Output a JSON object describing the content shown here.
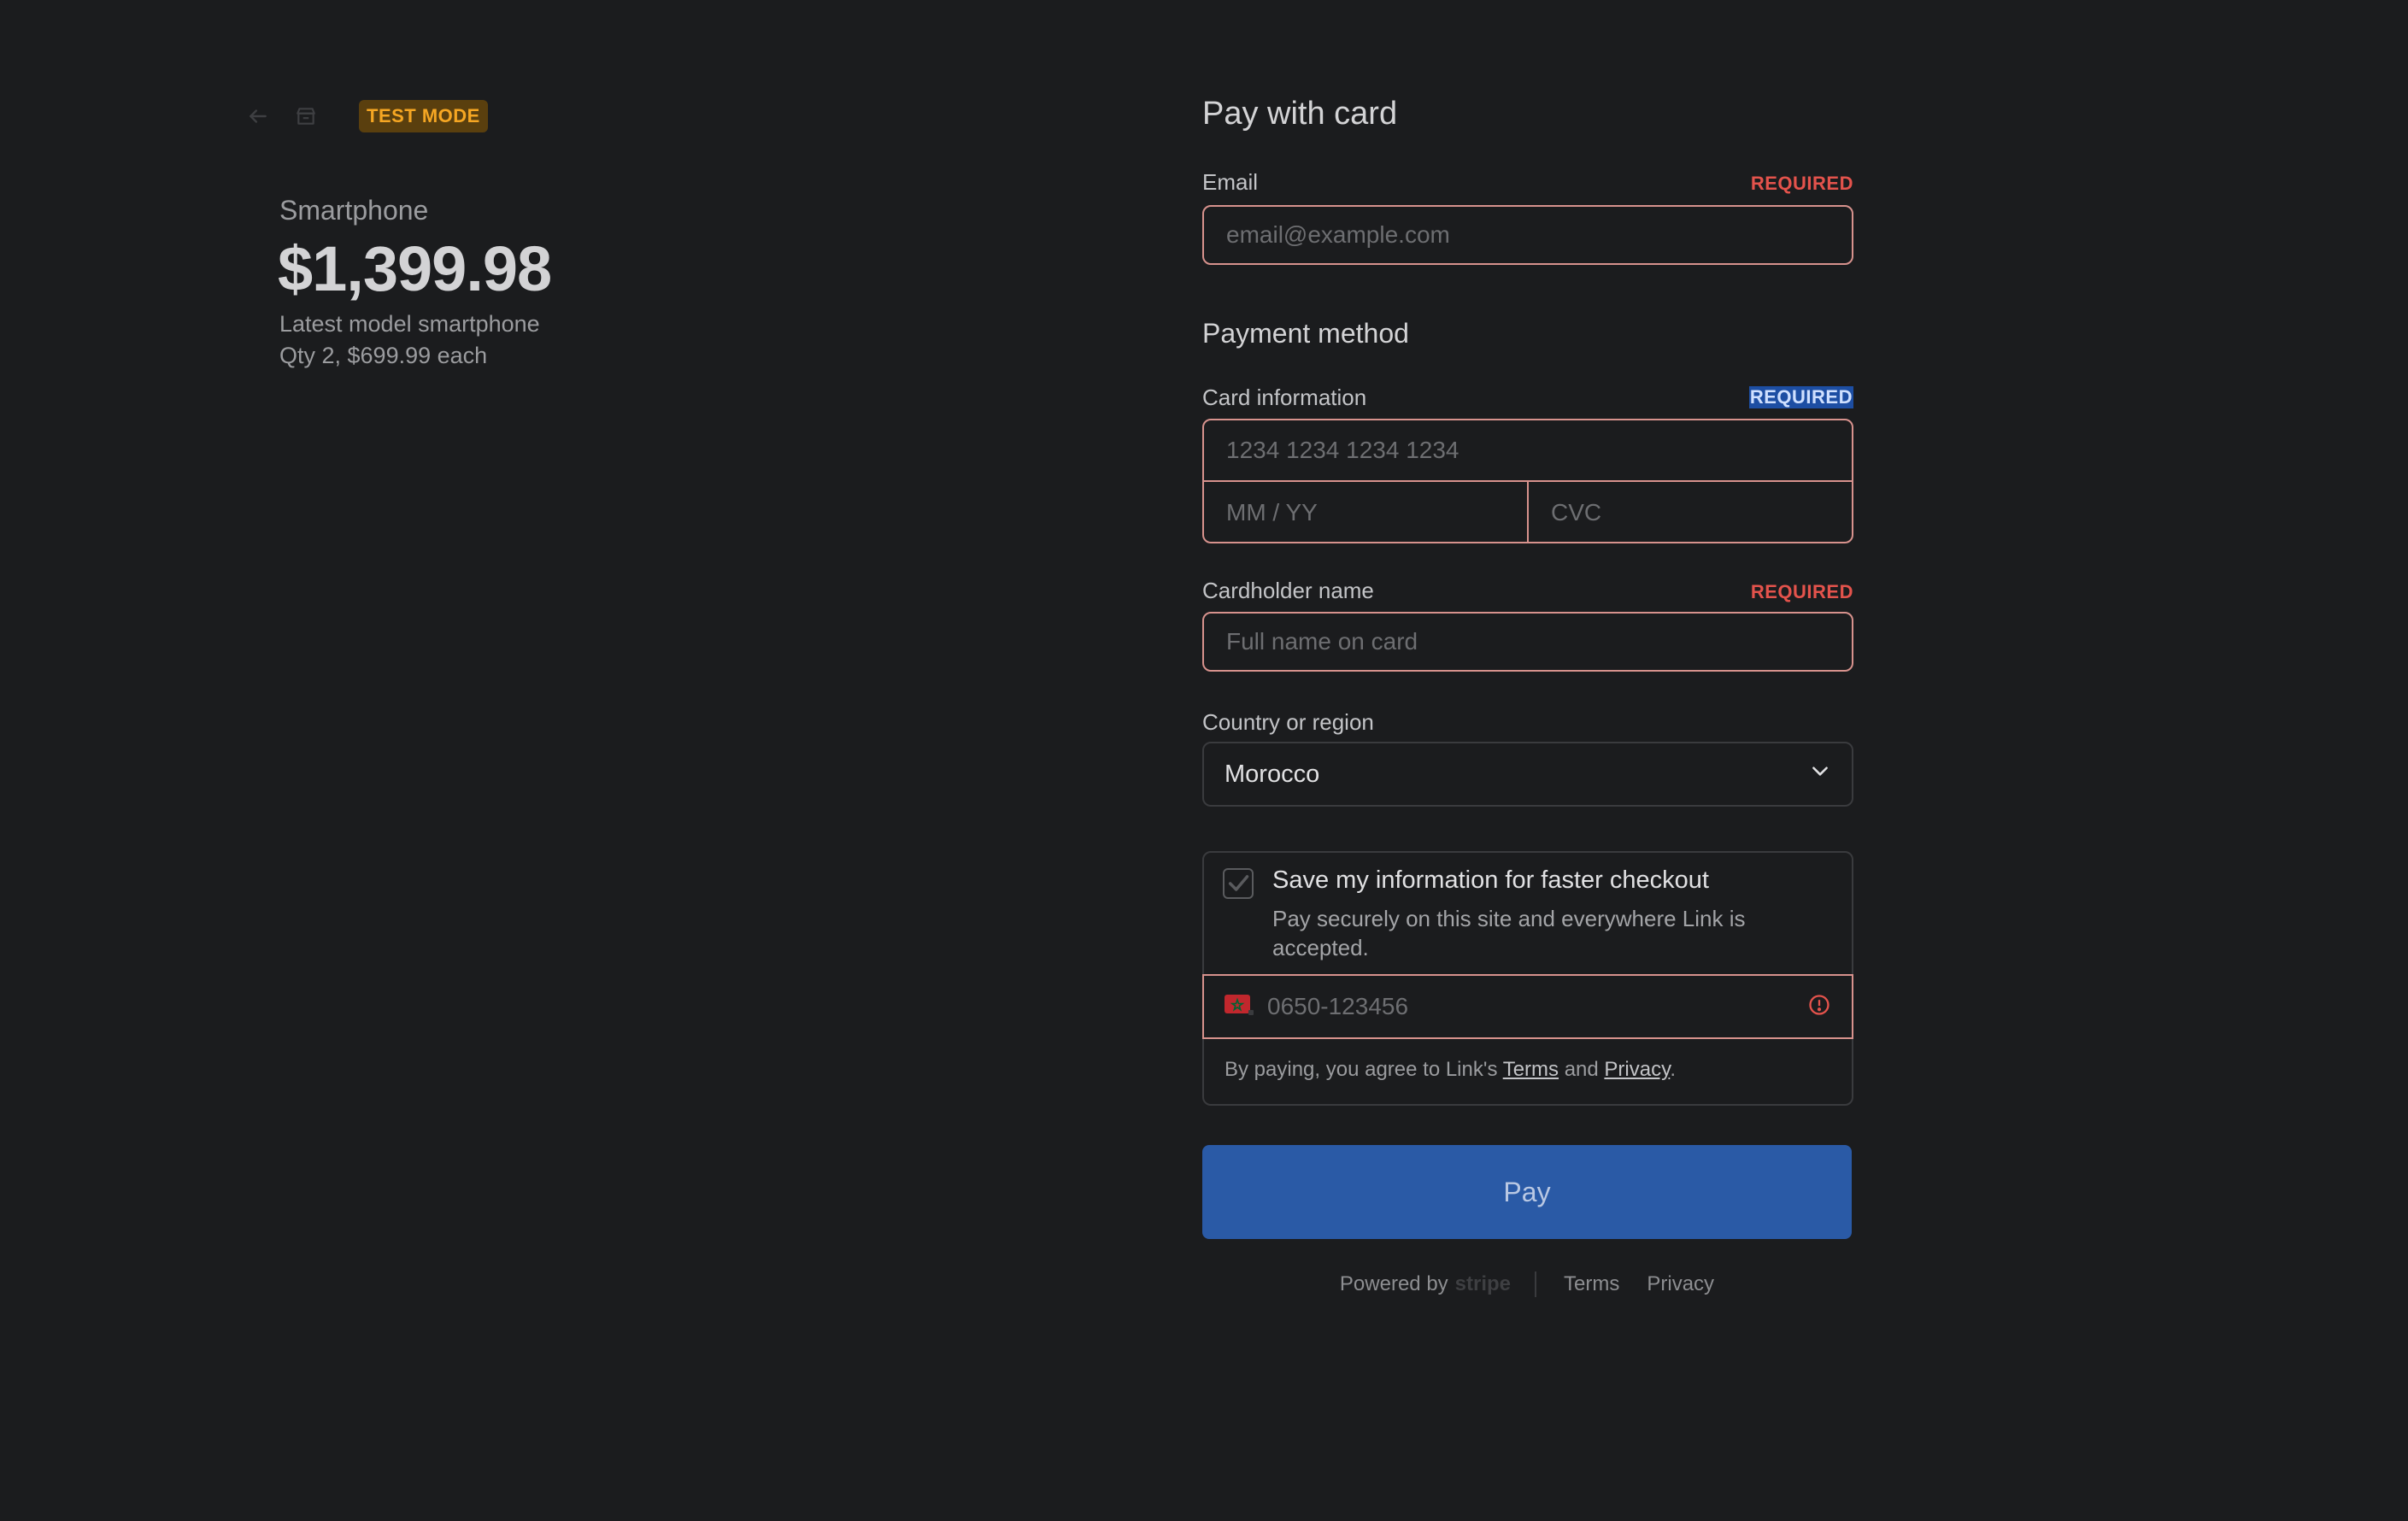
{
  "header": {
    "badge": "TEST MODE"
  },
  "summary": {
    "product_name": "Smartphone",
    "price": "$1,399.98",
    "description": "Latest model smartphone",
    "quantity_line": "Qty 2, $699.99 each"
  },
  "form": {
    "title": "Pay with card",
    "email": {
      "label": "Email",
      "required": "REQUIRED",
      "placeholder": "email@example.com"
    },
    "payment_method_heading": "Payment method",
    "card": {
      "label": "Card information",
      "required": "REQUIRED",
      "number_placeholder": "1234 1234 1234 1234",
      "expiry_placeholder": "MM / YY",
      "cvc_placeholder": "CVC"
    },
    "cardholder": {
      "label": "Cardholder name",
      "required": "REQUIRED",
      "placeholder": "Full name on card"
    },
    "country": {
      "label": "Country or region",
      "value": "Morocco"
    },
    "link": {
      "title": "Save my information for faster checkout",
      "description": "Pay securely on this site and everywhere Link is accepted.",
      "phone_placeholder": "0650-123456",
      "terms_prefix": "By paying, you agree to Link's",
      "terms_link": "Terms",
      "terms_and": "and",
      "privacy_link": "Privacy",
      "terms_suffix": "."
    },
    "pay_button": "Pay"
  },
  "footer": {
    "powered_by": "Powered by",
    "brand": "stripe",
    "terms": "Terms",
    "privacy": "Privacy"
  },
  "colors": {
    "background": "#1b1c1e",
    "error": "#e4534c",
    "badge_bg": "#5a3f0e",
    "badge_text": "#f5a623",
    "pay_button": "#2a5aa6"
  }
}
